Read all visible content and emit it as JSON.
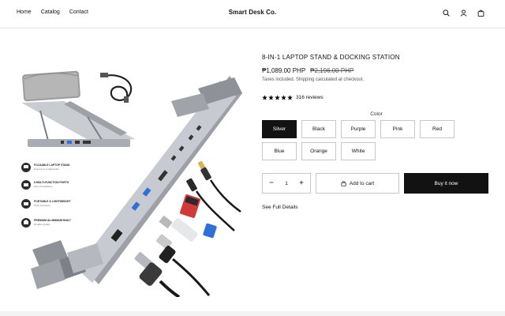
{
  "nav": {
    "home": "Home",
    "catalog": "Catalog",
    "contact": "Contact"
  },
  "brand": "Smart Desk Co.",
  "header_icons": [
    "search-icon",
    "account-icon",
    "cart-icon"
  ],
  "product": {
    "title": "8-IN-1 LAPTOP STAND & DOCKING STATION",
    "price": "₱1,089.00 PHP",
    "compare_price": "₱2,196.00 PHP",
    "taxes": "Taxes included. Shipping calculated at checkout.",
    "rating_stars": 5,
    "reviews": "316 reviews",
    "color_label": "Color",
    "colors": [
      "Silver",
      "Black",
      "Purple",
      "Pink",
      "Red",
      "Blue",
      "Orange",
      "White"
    ],
    "selected_color": "Silver",
    "quantity": "1",
    "add_to_cart": "Add to cart",
    "buy_now": "Buy it now",
    "see_details": "See Full Details"
  },
  "image_features": [
    {
      "title": "FOLDABLE LAPTOP STAND",
      "sub": "Ergonomic & Adjustable"
    },
    {
      "title": "8 MULTI-FUNCTION PORTS",
      "sub": "More Possibilities"
    },
    {
      "title": "PORTABLE & LIGHTWEIGHT",
      "sub": "Work Anywhere"
    },
    {
      "title": "PREMIUM ALUMINIUM BUILT",
      "sub": "Durable Quality"
    }
  ],
  "colors": {
    "primary": "#121212",
    "border": "#c8c8c8",
    "aluminium": "#b9bdc3",
    "usb_blue": "#2f6fd6",
    "sd_red": "#d23a3a"
  }
}
